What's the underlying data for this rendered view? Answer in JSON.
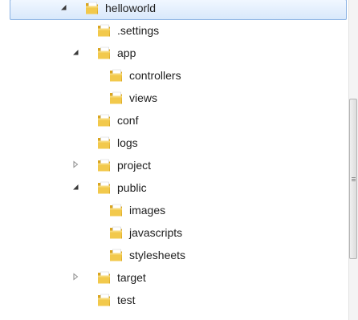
{
  "tree": {
    "items": [
      {
        "label": "helloworld",
        "expander": "expanded",
        "depth": 0,
        "selected": true
      },
      {
        "label": ".settings",
        "expander": "none",
        "depth": 1
      },
      {
        "label": "app",
        "expander": "expanded",
        "depth": 1
      },
      {
        "label": "controllers",
        "expander": "none",
        "depth": 2
      },
      {
        "label": "views",
        "expander": "none",
        "depth": 2
      },
      {
        "label": "conf",
        "expander": "none",
        "depth": 1
      },
      {
        "label": "logs",
        "expander": "none",
        "depth": 1
      },
      {
        "label": "project",
        "expander": "collapsed",
        "depth": 1
      },
      {
        "label": "public",
        "expander": "expanded",
        "depth": 1
      },
      {
        "label": "images",
        "expander": "none",
        "depth": 2
      },
      {
        "label": "javascripts",
        "expander": "none",
        "depth": 2
      },
      {
        "label": "stylesheets",
        "expander": "none",
        "depth": 2
      },
      {
        "label": "target",
        "expander": "collapsed",
        "depth": 1
      },
      {
        "label": "test",
        "expander": "none",
        "depth": 1
      }
    ]
  },
  "icons": {
    "folder": "folder-icon",
    "expanded": "expanded-arrow-icon",
    "collapsed": "collapsed-arrow-icon"
  },
  "colors": {
    "selection_border": "#8ab2e3",
    "selection_fill": "#d8e8fb",
    "folder_yellow": "#f2c94c"
  }
}
